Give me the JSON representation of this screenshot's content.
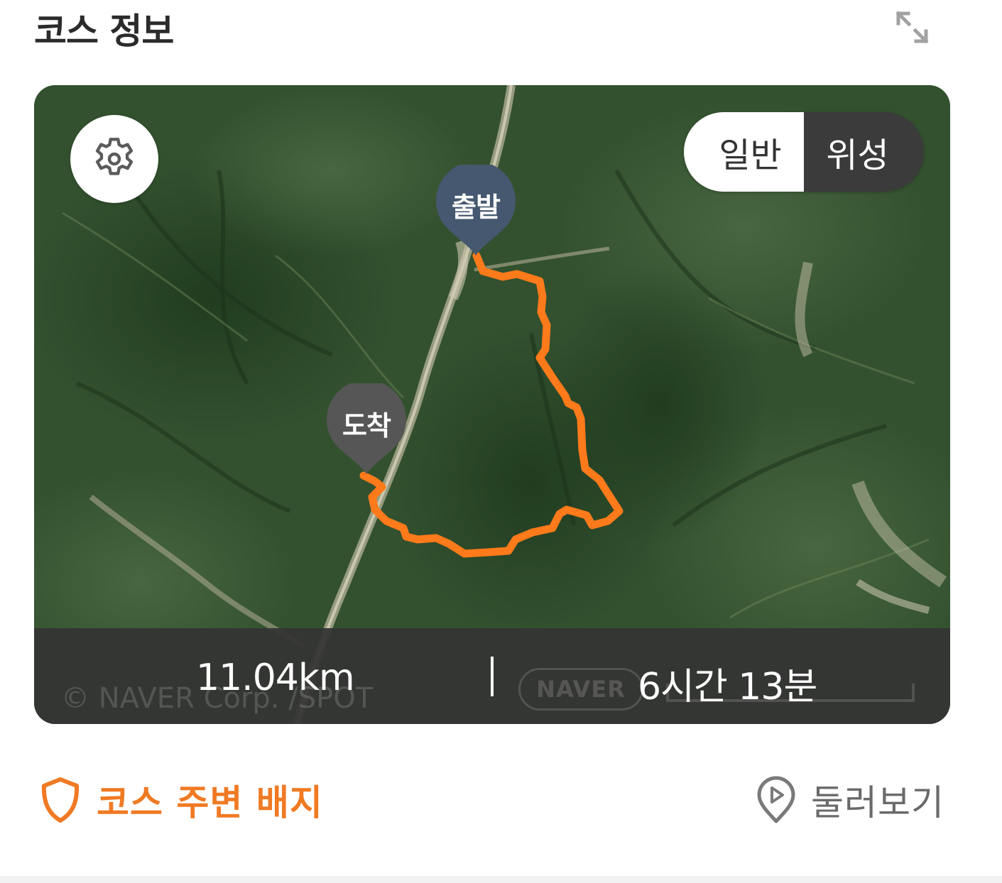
{
  "header": {
    "title": "코스 정보",
    "expand_icon": "expand-arrows-icon"
  },
  "map": {
    "settings_icon": "gear-icon",
    "map_type": {
      "options": [
        "일반",
        "위성"
      ],
      "selected": "위성"
    },
    "markers": {
      "start": "출발",
      "end": "도착"
    },
    "route_color": "#ff7a1a",
    "attribution": "© NAVER Corp. /SPOT",
    "naver_logo": "NAVER"
  },
  "stats": {
    "distance": "11.04km",
    "duration": "6시간 13분"
  },
  "actions": {
    "badges_label": "코스 주변 배지",
    "badges_icon": "shield-icon",
    "badges_color": "#f07a24",
    "tour_label": "둘러보기",
    "tour_icon": "play-location-pin-icon"
  }
}
